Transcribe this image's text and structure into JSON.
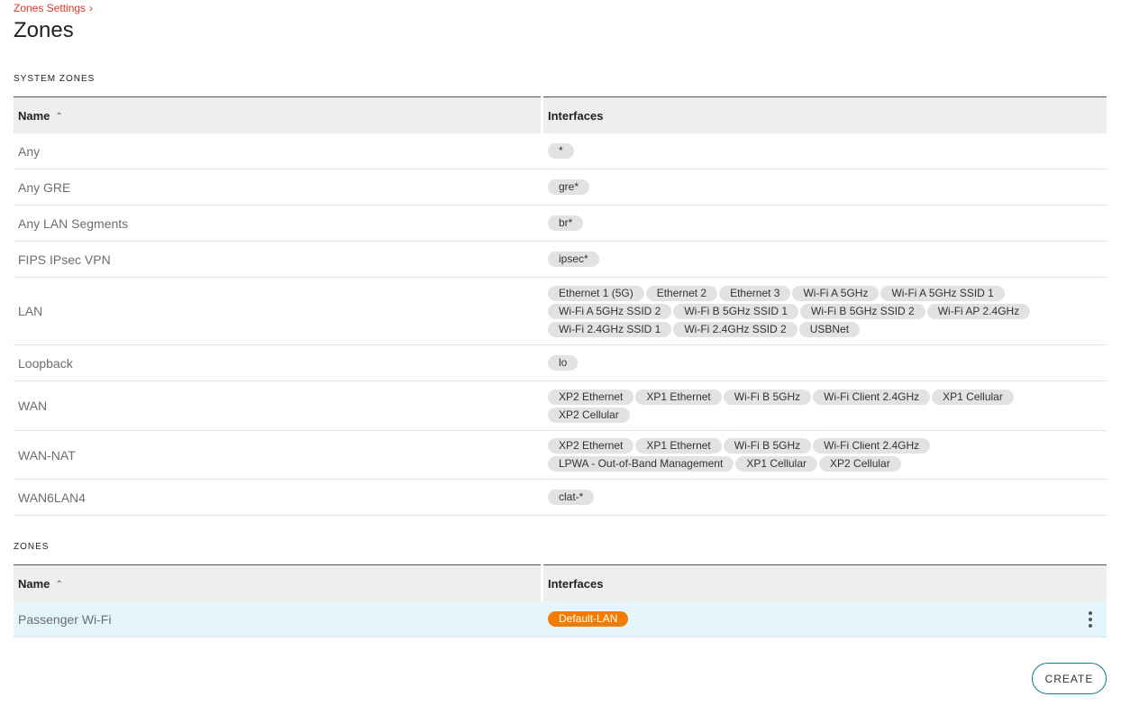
{
  "breadcrumb": {
    "parent": "Zones Settings"
  },
  "page_title": "Zones",
  "system_zones": {
    "section_title": "SYSTEM ZONES",
    "columns": {
      "name": "Name",
      "interfaces": "Interfaces"
    },
    "rows": [
      {
        "name": "Any",
        "interfaces": [
          "*"
        ]
      },
      {
        "name": "Any GRE",
        "interfaces": [
          "gre*"
        ]
      },
      {
        "name": "Any LAN Segments",
        "interfaces": [
          "br*"
        ]
      },
      {
        "name": "FIPS IPsec VPN",
        "interfaces": [
          "ipsec*"
        ]
      },
      {
        "name": "LAN",
        "interfaces": [
          "Ethernet 1 (5G)",
          "Ethernet 2",
          "Ethernet 3",
          "Wi-Fi A 5GHz",
          "Wi-Fi A 5GHz SSID 1",
          "Wi-Fi A 5GHz SSID 2",
          "Wi-Fi B 5GHz SSID 1",
          "Wi-Fi B 5GHz SSID 2",
          "Wi-Fi AP 2.4GHz",
          "Wi-Fi 2.4GHz SSID 1",
          "Wi-Fi 2.4GHz SSID 2",
          "USBNet"
        ]
      },
      {
        "name": "Loopback",
        "interfaces": [
          "lo"
        ]
      },
      {
        "name": "WAN",
        "interfaces": [
          "XP2 Ethernet",
          "XP1 Ethernet",
          "Wi-Fi B 5GHz",
          "Wi-Fi Client 2.4GHz",
          "XP1 Cellular",
          "XP2 Cellular"
        ]
      },
      {
        "name": "WAN-NAT",
        "interfaces": [
          "XP2 Ethernet",
          "XP1 Ethernet",
          "Wi-Fi B 5GHz",
          "Wi-Fi Client 2.4GHz",
          "LPWA - Out-of-Band Management",
          "XP1 Cellular",
          "XP2 Cellular"
        ]
      },
      {
        "name": "WAN6LAN4",
        "interfaces": [
          "clat-*"
        ]
      }
    ]
  },
  "zones": {
    "section_title": "ZONES",
    "columns": {
      "name": "Name",
      "interfaces": "Interfaces"
    },
    "rows": [
      {
        "name": "Passenger Wi-Fi",
        "interfaces": [
          "Default-LAN"
        ]
      }
    ]
  },
  "create_button": "CREATE",
  "colors": {
    "accent": "#d9352b",
    "chip_orange": "#f07d00",
    "highlight_row": "#e4f5fb",
    "button_border": "#0f7c8c"
  }
}
